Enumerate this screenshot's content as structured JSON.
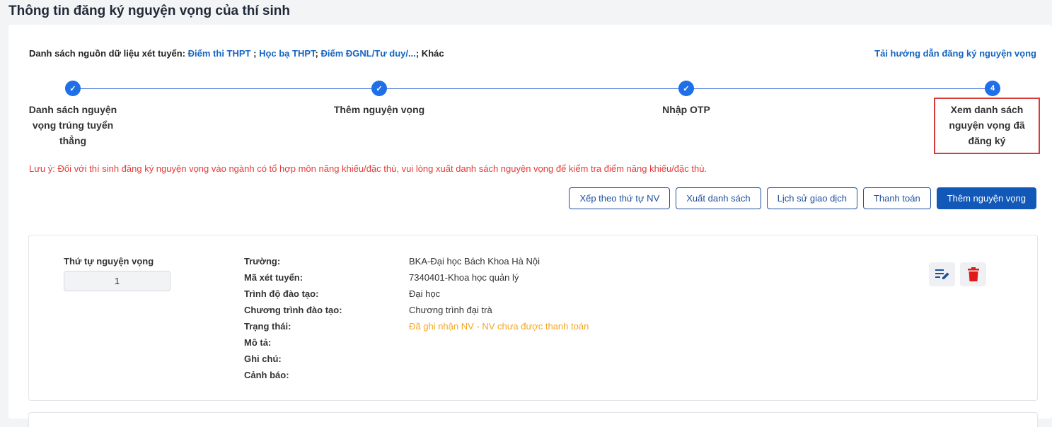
{
  "page": {
    "title": "Thông tin đăng ký nguyện vọng của thí sinh"
  },
  "sources": {
    "prefix": "Danh sách nguồn dữ liệu xét tuyển: ",
    "items": [
      "Điểm thi THPT",
      " ; ",
      "Học bạ THPT",
      "; ",
      "Điểm ĐGNL/Tư duy/...",
      "; Khác"
    ]
  },
  "guide_link": "Tải hướng dẫn đăng ký nguyện vọng",
  "steps": [
    {
      "label": "Danh sách nguyện vọng trúng tuyển thẳng",
      "marker": "✓"
    },
    {
      "label": "Thêm nguyện vọng",
      "marker": "✓"
    },
    {
      "label": "Nhập OTP",
      "marker": "✓"
    },
    {
      "label": "Xem danh sách nguyện vọng đã đăng ký",
      "marker": "4"
    }
  ],
  "note": "Lưu ý: Đối với thí sinh đăng ký nguyện vọng vào ngành có tổ hợp môn năng khiếu/đặc thù, vui lòng xuất danh sách nguyện vọng để kiểm tra điểm năng khiếu/đặc thù.",
  "actions": {
    "sort": "Xếp theo thứ tự NV",
    "export": "Xuất danh sách",
    "history": "Lịch sử giao dịch",
    "payment": "Thanh toán",
    "add": "Thêm nguyện vọng"
  },
  "nv": {
    "order_label": "Thứ tự nguyện vọng",
    "order_value": "1",
    "fields": [
      {
        "key": "Trường:",
        "value": "BKA-Đại học Bách Khoa Hà Nội"
      },
      {
        "key": "Mã xét tuyển:",
        "value": "7340401-Khoa học quản lý"
      },
      {
        "key": "Trình độ đào tạo:",
        "value": "Đại học"
      },
      {
        "key": "Chương trình đào tạo:",
        "value": "Chương trình đại trà"
      },
      {
        "key": "Trạng thái:",
        "value": "Đã ghi nhận NV - NV chưa được thanh toán"
      },
      {
        "key": "Mô tả:",
        "value": ""
      },
      {
        "key": "Ghi chú:",
        "value": ""
      },
      {
        "key": "Cảnh báo:",
        "value": ""
      }
    ]
  },
  "colors": {
    "accent": "#1158b8",
    "step": "#1e6fe8",
    "warn": "#f5a623",
    "danger": "#e53935"
  },
  "icons": {
    "edit": "edit-list-icon",
    "delete": "trash-icon"
  }
}
